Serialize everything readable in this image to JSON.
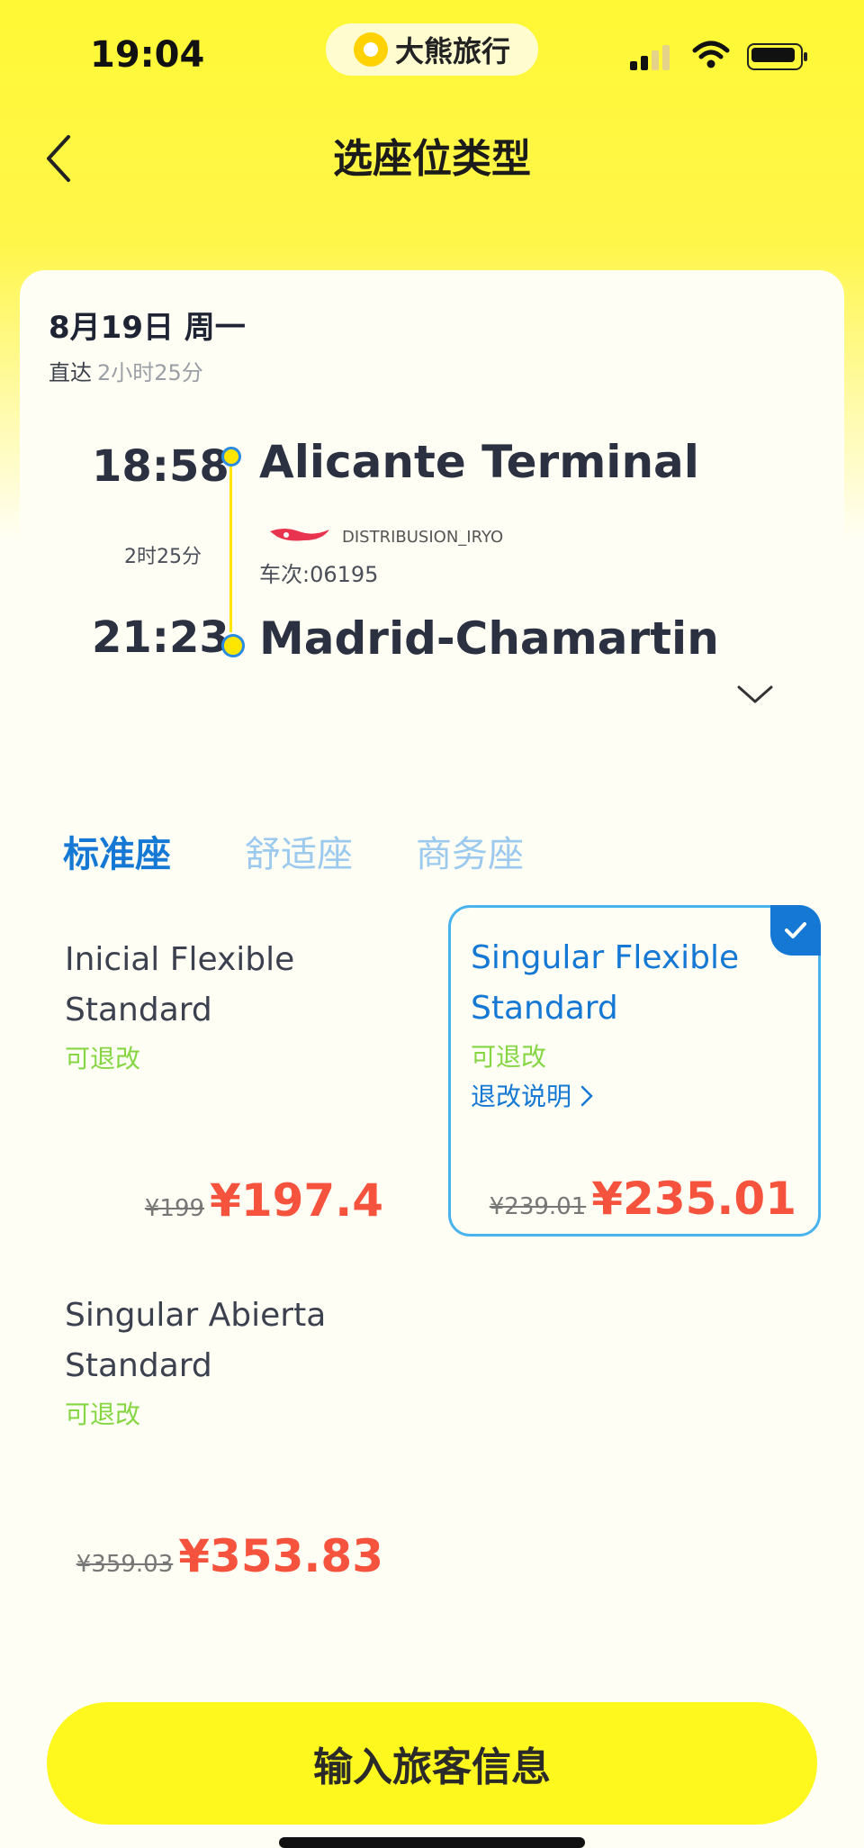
{
  "status_bar": {
    "time": "19:04",
    "app_name": "大熊旅行"
  },
  "header": {
    "title": "选座位类型"
  },
  "trip": {
    "date": "8月19日 周一",
    "direct_label": "直达",
    "total_duration": "2小时25分",
    "departure_time": "18:58",
    "departure_station": "Alicante Terminal",
    "middle_duration": "2时25分",
    "operator": "DISTRIBUSION_IRYO",
    "train_number": "车次:06195",
    "arrival_time": "21:23",
    "arrival_station": "Madrid-Chamartin"
  },
  "tabs": [
    {
      "label": "标准座",
      "active": true
    },
    {
      "label": "舒适座",
      "active": false
    },
    {
      "label": "商务座",
      "active": false
    }
  ],
  "fares": [
    {
      "name": "Inicial Flexible Standard",
      "refund": "可退改",
      "original_price": "¥199",
      "price": "¥197.4",
      "selected": false
    },
    {
      "name": "Singular Flexible Standard",
      "refund": "可退改",
      "refund_rules": "退改说明",
      "original_price": "¥239.01",
      "price": "¥235.01",
      "selected": true
    },
    {
      "name": "Singular Abierta Standard",
      "refund": "可退改",
      "original_price": "¥359.03",
      "price": "¥353.83",
      "selected": false
    }
  ],
  "cta": {
    "label": "输入旅客信息"
  },
  "colors": {
    "brand_yellow": "#FFF81E",
    "accent_blue": "#1478D4",
    "price_red": "#F5533D",
    "refund_green": "#86D644"
  }
}
